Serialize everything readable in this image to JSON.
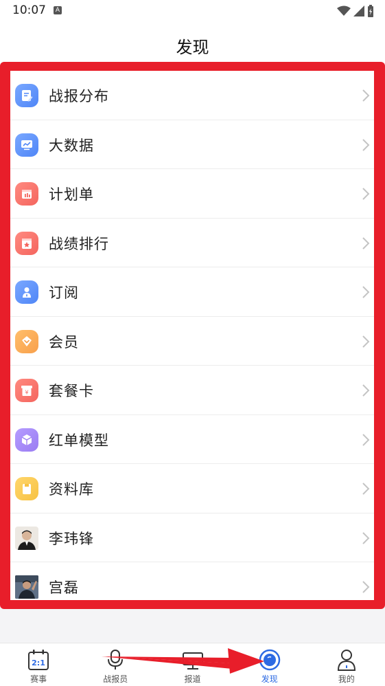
{
  "status_bar": {
    "time": "10:07",
    "badge": "A"
  },
  "header": {
    "title": "发现"
  },
  "menu": [
    {
      "label": "战报分布",
      "icon": "report-icon",
      "color": "#5b8ff9"
    },
    {
      "label": "大数据",
      "icon": "monitor-chart-icon",
      "color": "#4f86f7"
    },
    {
      "label": "计划单",
      "icon": "calendar-icon",
      "color": "#f4655e"
    },
    {
      "label": "战绩排行",
      "icon": "ranking-icon",
      "color": "#f4655e"
    },
    {
      "label": "订阅",
      "icon": "user-subscribe-icon",
      "color": "#4f86f7"
    },
    {
      "label": "会员",
      "icon": "diamond-icon",
      "color": "#f8a04b"
    },
    {
      "label": "套餐卡",
      "icon": "package-card-icon",
      "color": "#f4655e"
    },
    {
      "label": "红单模型",
      "icon": "cube-icon",
      "color": "#9a7cf2"
    },
    {
      "label": "资料库",
      "icon": "folder-icon",
      "color": "#f7c243"
    },
    {
      "label": "李玮锋",
      "icon": "avatar-photo",
      "color": "#e8e4de"
    },
    {
      "label": "宫磊",
      "icon": "avatar-photo",
      "color": "#6b7a8c"
    }
  ],
  "tabs": [
    {
      "label": "赛事",
      "icon": "calendar-score-icon",
      "badge_text": "2:1",
      "active": false
    },
    {
      "label": "战报员",
      "icon": "microphone-icon",
      "active": false
    },
    {
      "label": "报道",
      "icon": "screen-icon",
      "active": false
    },
    {
      "label": "发现",
      "icon": "compass-icon",
      "active": true
    },
    {
      "label": "我的",
      "icon": "person-icon",
      "active": false
    }
  ],
  "colors": {
    "accent": "#2d6ae3",
    "highlight_frame": "#e81e2a"
  }
}
